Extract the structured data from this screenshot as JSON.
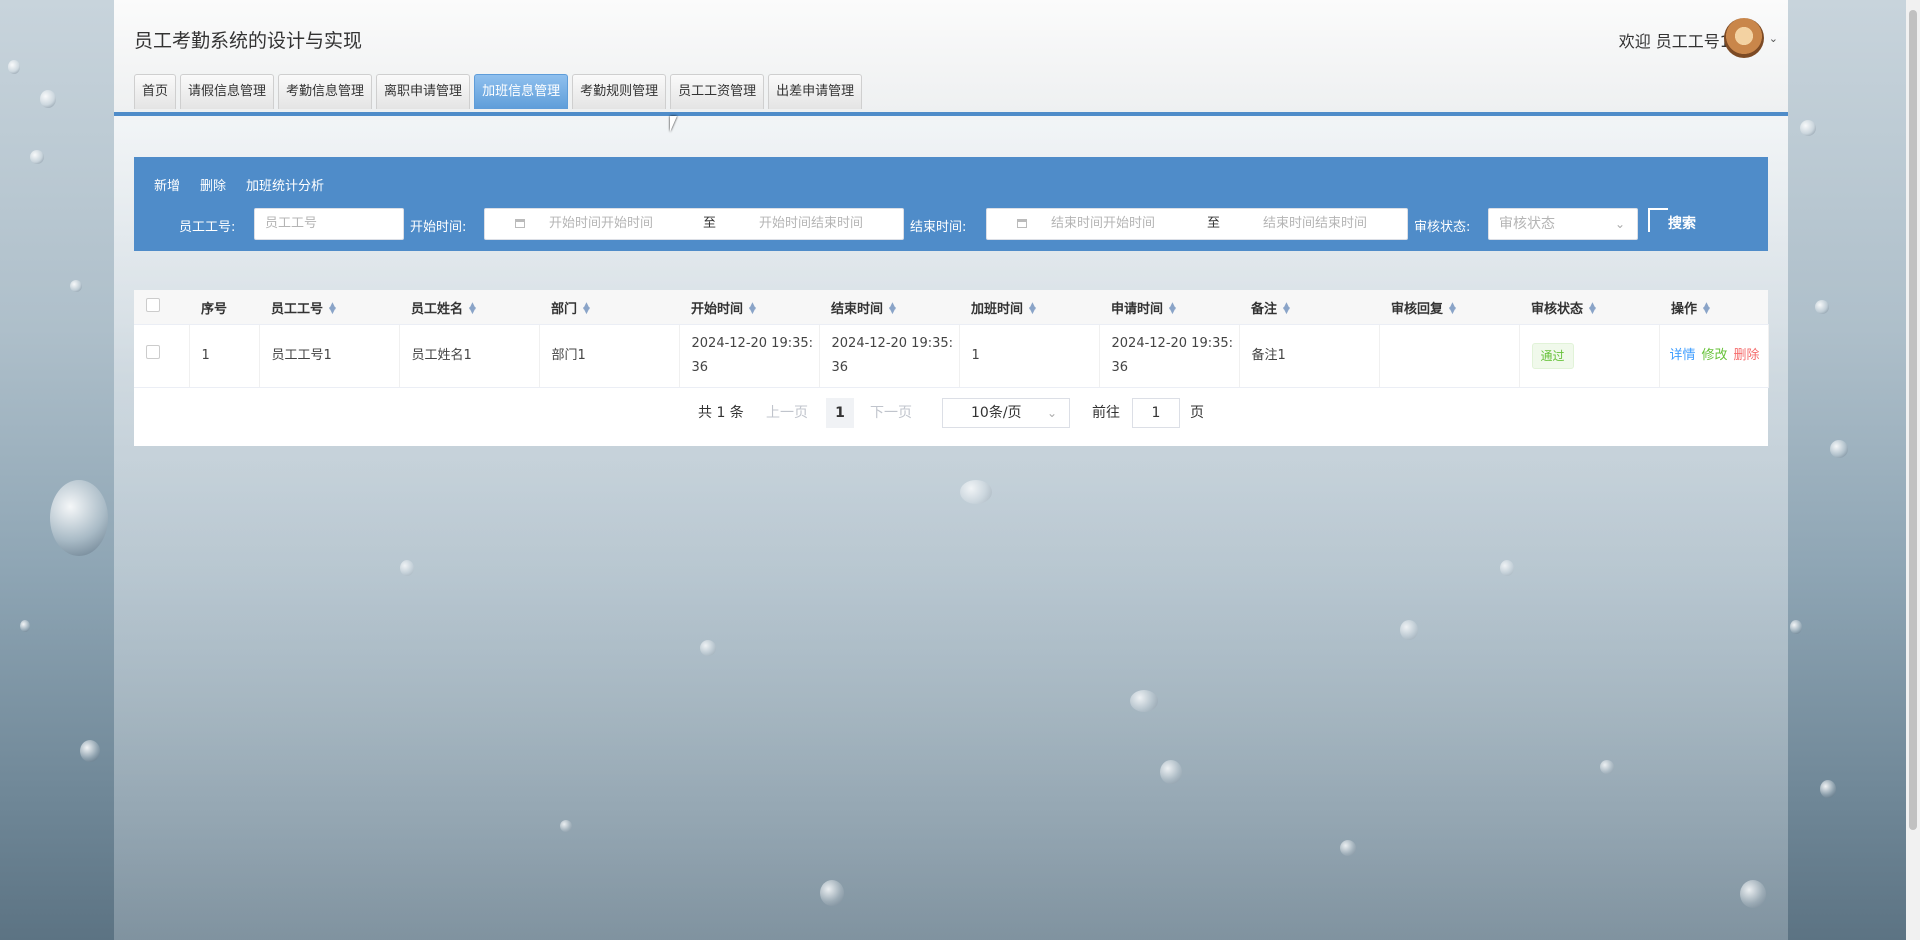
{
  "header": {
    "title": "员工考勤系统的设计与实现",
    "welcome": "欢迎 员工工号1",
    "avatar_icon": "user-avatar",
    "caret_icon": "chevron-down-icon"
  },
  "nav": {
    "items": [
      {
        "label": "首页"
      },
      {
        "label": "请假信息管理"
      },
      {
        "label": "考勤信息管理"
      },
      {
        "label": "离职申请管理"
      },
      {
        "label": "加班信息管理",
        "active": true
      },
      {
        "label": "考勤规则管理"
      },
      {
        "label": "员工工资管理"
      },
      {
        "label": "出差申请管理"
      }
    ]
  },
  "toolbar": {
    "add_label": "新增",
    "delete_label": "删除",
    "stats_label": "加班统计分析"
  },
  "search": {
    "emp_no_label": "员工工号:",
    "emp_no_placeholder": "员工工号",
    "start_time_label": "开始时间:",
    "start_from_placeholder": "开始时间开始时间",
    "start_to_placeholder": "开始时间结束时间",
    "end_time_label": "结束时间:",
    "end_from_placeholder": "结束时间开始时间",
    "end_to_placeholder": "结束时间结束时间",
    "range_separator": "至",
    "status_label": "审核状态:",
    "status_placeholder": "审核状态",
    "search_button": "搜索"
  },
  "table": {
    "headers": {
      "index": "序号",
      "emp_no": "员工工号",
      "emp_name": "员工姓名",
      "dept": "部门",
      "start": "开始时间",
      "end": "结束时间",
      "hours": "加班时间",
      "apply": "申请时间",
      "remark": "备注",
      "reply": "审核回复",
      "status": "审核状态",
      "ops": "操作"
    },
    "rows": [
      {
        "index": "1",
        "emp_no": "员工工号1",
        "emp_name": "员工姓名1",
        "dept": "部门1",
        "start": "2024-12-20 19:35:36",
        "end": "2024-12-20 19:35:36",
        "hours": "1",
        "apply": "2024-12-20 19:35:36",
        "remark": "备注1",
        "reply": "",
        "status": "通过",
        "op_detail": "详情",
        "op_edit": "修改",
        "op_delete": "删除"
      }
    ]
  },
  "pager": {
    "total": "共 1 条",
    "prev": "上一页",
    "page": "1",
    "next": "下一页",
    "size": "10条/页",
    "goto": "前往",
    "goto_value": "1",
    "page_unit": "页"
  },
  "colors": {
    "accent": "#4f8cc9",
    "nav_active": "#5f9dd9",
    "success": "#67c23a",
    "danger": "#f56c6c",
    "link": "#409eff"
  }
}
